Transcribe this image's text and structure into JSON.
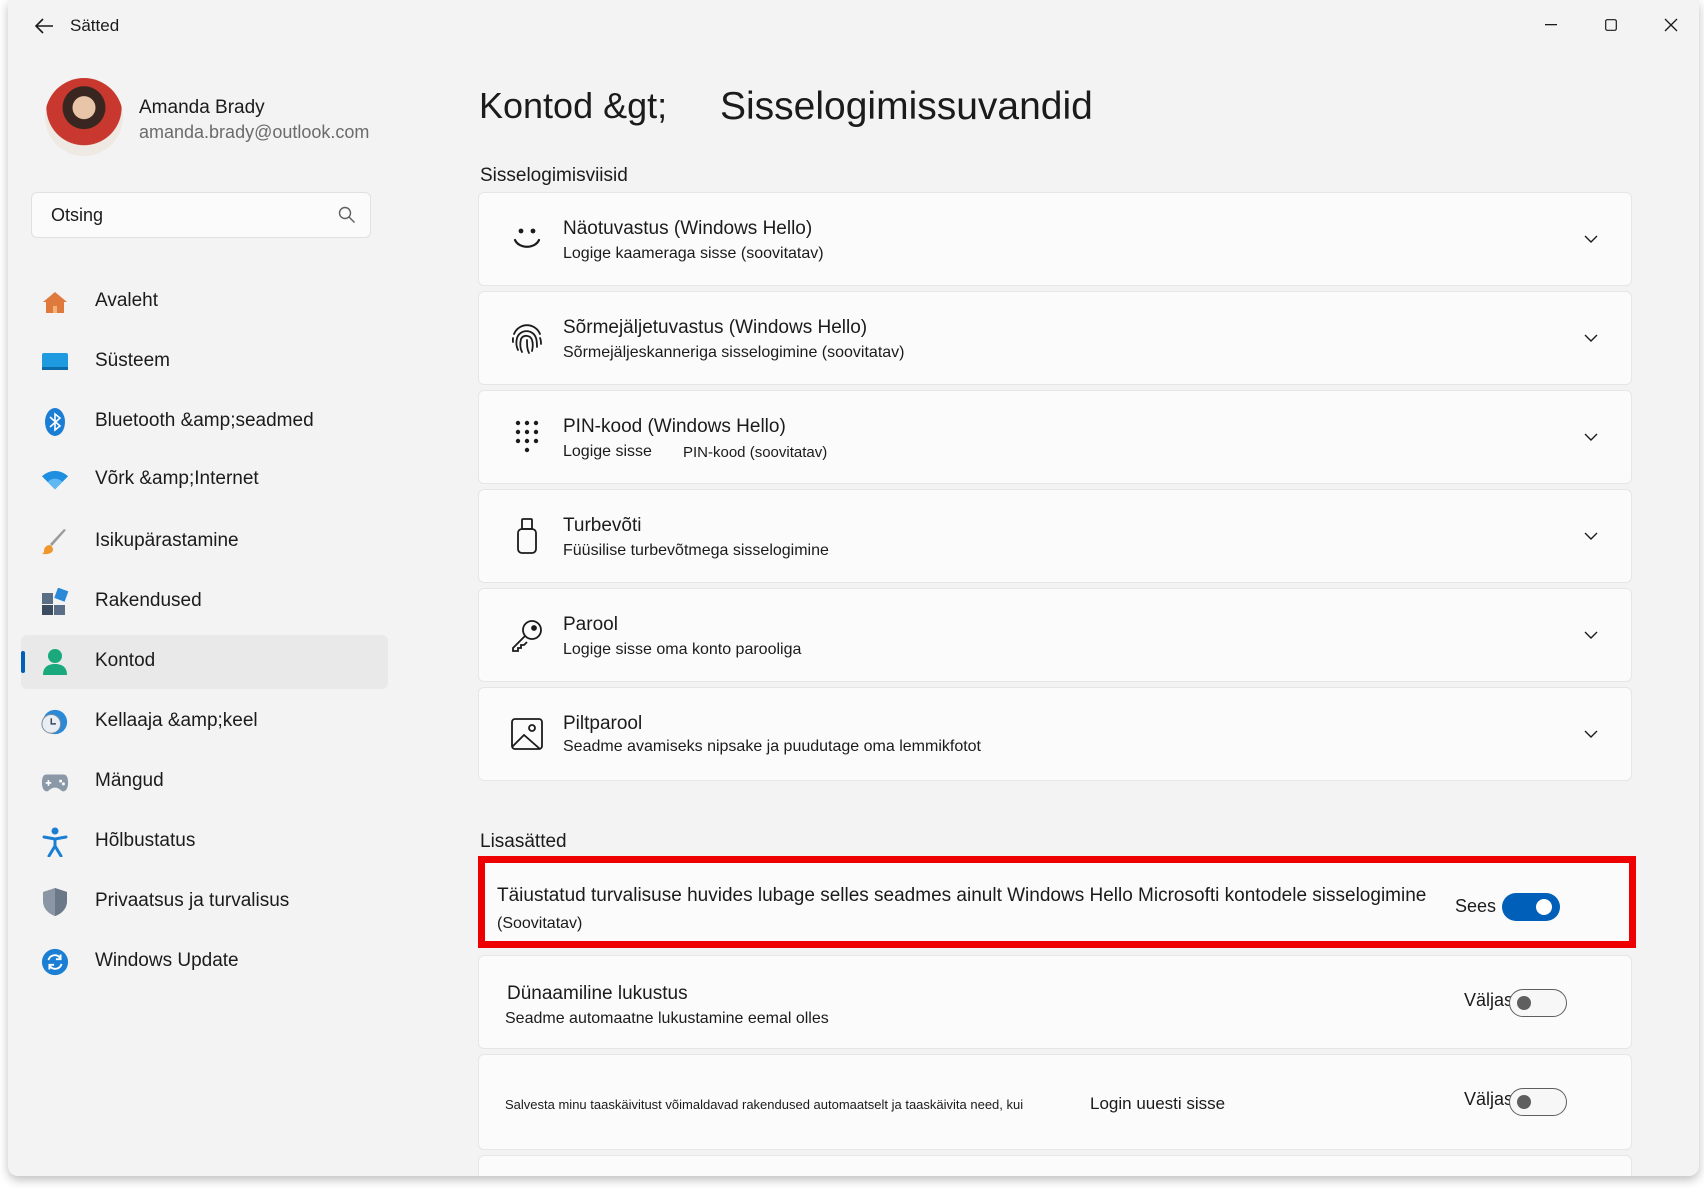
{
  "window": {
    "title": "Sätted"
  },
  "profile": {
    "name": "Amanda Brady",
    "email": "amanda.brady@outlook.com"
  },
  "search": {
    "placeholder": "Otsing"
  },
  "nav": {
    "items": [
      {
        "label": "Avaleht",
        "icon": "home-icon"
      },
      {
        "label": "Süsteem",
        "icon": "system-icon"
      },
      {
        "label": "Bluetooth &amp;seadmed",
        "icon": "bluetooth-icon"
      },
      {
        "label": "Võrk &amp;Internet",
        "icon": "wifi-icon"
      },
      {
        "label": "Isikupärastamine",
        "icon": "brush-icon"
      },
      {
        "label": "Rakendused",
        "icon": "apps-icon"
      },
      {
        "label": "Kontod",
        "icon": "account-icon",
        "active": true
      },
      {
        "label": "Kellaaja &amp;keel",
        "icon": "time-language-icon"
      },
      {
        "label": "Mängud",
        "icon": "gamepad-icon"
      },
      {
        "label": "Hõlbustatus",
        "icon": "accessibility-icon"
      },
      {
        "label": "Privaatsus ja turvalisus",
        "icon": "shield-icon"
      },
      {
        "label": "Windows Update",
        "icon": "update-icon"
      }
    ]
  },
  "breadcrumb": {
    "parent": "Kontod &gt;",
    "current": "Sisselogimissuvandid"
  },
  "signin_section": {
    "heading": "Sisselogimisviisid",
    "options": [
      {
        "title": "Näotuvastus (Windows Hello)",
        "subtitle": "Logige kaameraga sisse (soovitatav)",
        "icon": "face-icon"
      },
      {
        "title": "Sõrmejäljetuvastus (Windows Hello)",
        "subtitle": "Sõrmejäljeskanneriga sisselogimine (soovitatav)",
        "icon": "fingerprint-icon"
      },
      {
        "title": "PIN-kood (Windows Hello)",
        "subtitle": "Logige sisse",
        "subtitle_extra": "PIN-kood (soovitatav)",
        "icon": "keypad-icon"
      },
      {
        "title": "Turbevõti",
        "subtitle": "Füüsilise turbevõtmega sisselogimine",
        "icon": "usb-key-icon"
      },
      {
        "title": "Parool",
        "subtitle": "Logige sisse oma konto parooliga",
        "icon": "key-icon"
      },
      {
        "title": "Piltparool",
        "subtitle": "Seadme avamiseks nipsake ja puudutage oma lemmikfotot",
        "icon": "picture-icon"
      }
    ]
  },
  "additional": {
    "heading": "Lisasätted",
    "hello_only": {
      "title": "Täiustatud turvalisuse huvides lubage selles seadmes ainult Windows Hello Microsofti kontodele sisselogimine",
      "subtitle": "(Soovitatav)",
      "state_label": "Sees",
      "on": true
    },
    "dynamic_lock": {
      "title": "Dünaamiline lukustus",
      "subtitle": "Seadme automaatne lukustamine eemal olles",
      "state_label": "Väljas",
      "on": false
    },
    "restart_apps": {
      "text": "Salvesta minu taaskäivitust võimaldavad rakendused automaatselt ja taaskäivita need, kui",
      "text_extra": "Login uuesti sisse",
      "state_label": "Väljas",
      "on": false
    }
  },
  "colors": {
    "accent": "#005fb8",
    "highlight_border": "#ee0000",
    "window_bg": "#f3f3f3",
    "card_bg": "#fbfbfb"
  }
}
